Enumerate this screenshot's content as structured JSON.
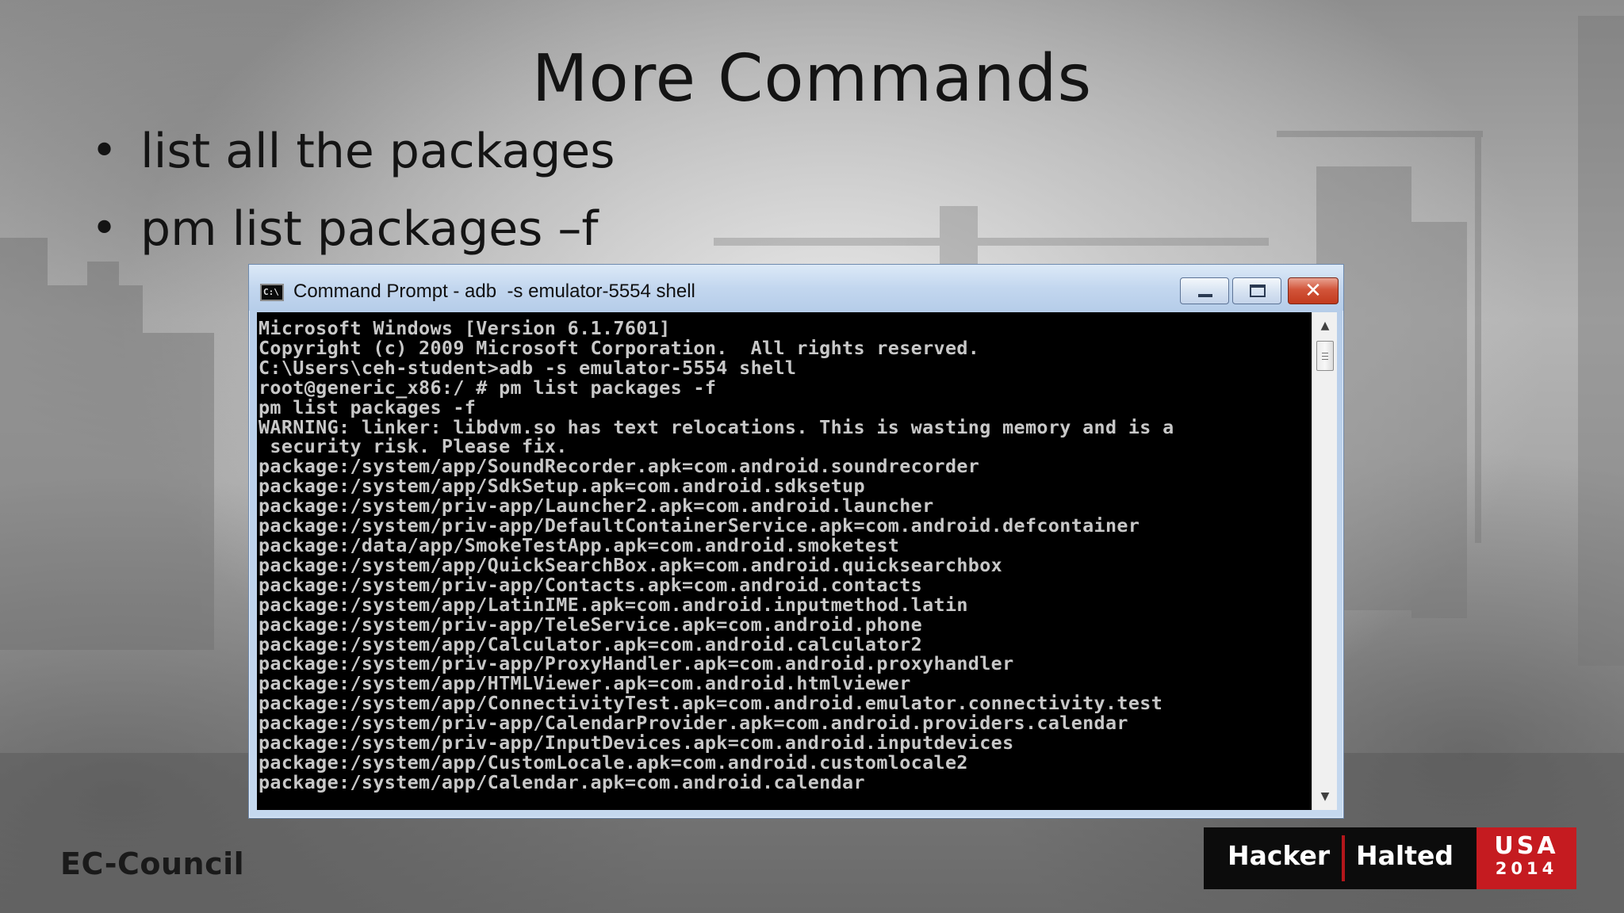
{
  "slide": {
    "title": "More Commands",
    "bullets": [
      {
        "text": "list all the packages"
      },
      {
        "text": "pm list packages –f"
      }
    ]
  },
  "window": {
    "icon_text": "C:\\",
    "title": "Command Prompt - adb  -s emulator-5554 shell"
  },
  "console": {
    "lines": [
      "Microsoft Windows [Version 6.1.7601]",
      "Copyright (c) 2009 Microsoft Corporation.  All rights reserved.",
      "",
      "C:\\Users\\ceh-student>adb -s emulator-5554 shell",
      "root@generic_x86:/ # pm list packages -f",
      "pm list packages -f",
      "WARNING: linker: libdvm.so has text relocations. This is wasting memory and is a",
      " security risk. Please fix.",
      "package:/system/app/SoundRecorder.apk=com.android.soundrecorder",
      "package:/system/app/SdkSetup.apk=com.android.sdksetup",
      "package:/system/priv-app/Launcher2.apk=com.android.launcher",
      "package:/system/priv-app/DefaultContainerService.apk=com.android.defcontainer",
      "package:/data/app/SmokeTestApp.apk=com.android.smoketest",
      "package:/system/app/QuickSearchBox.apk=com.android.quicksearchbox",
      "package:/system/priv-app/Contacts.apk=com.android.contacts",
      "package:/system/app/LatinIME.apk=com.android.inputmethod.latin",
      "package:/system/priv-app/TeleService.apk=com.android.phone",
      "package:/system/app/Calculator.apk=com.android.calculator2",
      "package:/system/priv-app/ProxyHandler.apk=com.android.proxyhandler",
      "package:/system/app/HTMLViewer.apk=com.android.htmlviewer",
      "package:/system/app/ConnectivityTest.apk=com.android.emulator.connectivity.test",
      "package:/system/priv-app/CalendarProvider.apk=com.android.providers.calendar",
      "package:/system/priv-app/InputDevices.apk=com.android.inputdevices",
      "package:/system/app/CustomLocale.apk=com.android.customlocale2",
      "package:/system/app/Calendar.apk=com.android.calendar"
    ]
  },
  "footer": {
    "ec_council": "EC-Council",
    "hh_hacker": "Hacker",
    "hh_halted": "Halted",
    "hh_country": "USA",
    "hh_year": "2014"
  },
  "colors": {
    "console_bg": "#000000",
    "console_text": "#c8c8c8",
    "close_button": "#c23a1e",
    "brand_red": "#c51b20"
  },
  "icons": {
    "bullet": "•",
    "minimize": "minimize-icon",
    "maximize": "maximize-icon",
    "close": "✕",
    "scroll_up": "▲",
    "scroll_down": "▼"
  }
}
